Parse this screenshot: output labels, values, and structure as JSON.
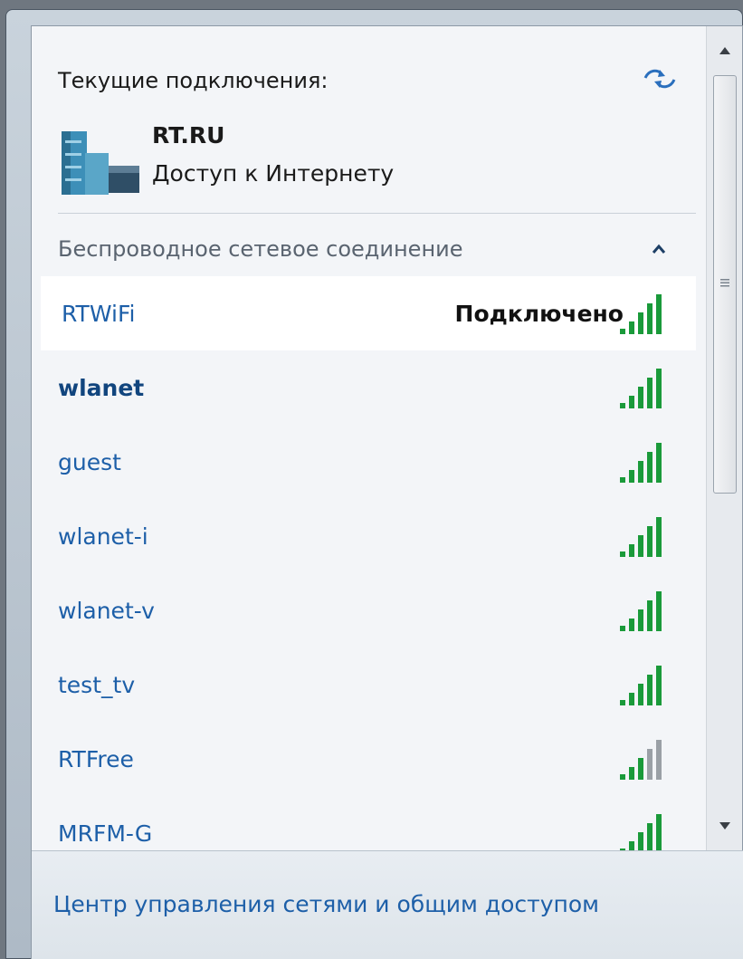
{
  "header": {
    "current_connections_title": "Текущие подключения:",
    "connection": {
      "name": "RT.RU",
      "status": "Доступ к Интернету"
    }
  },
  "section": {
    "label": "Беспроводное сетевое соединение"
  },
  "networks": [
    {
      "name": "RTWiFi",
      "state": "Подключено",
      "signal_bars": 5,
      "selected": true
    },
    {
      "name": "wlanet",
      "state": "",
      "signal_bars": 5,
      "bold": true
    },
    {
      "name": "guest",
      "state": "",
      "signal_bars": 5
    },
    {
      "name": "wlanet-i",
      "state": "",
      "signal_bars": 5
    },
    {
      "name": "wlanet-v",
      "state": "",
      "signal_bars": 5
    },
    {
      "name": "test_tv",
      "state": "",
      "signal_bars": 5
    },
    {
      "name": "RTFree",
      "state": "",
      "signal_bars": 3
    },
    {
      "name": "MRFM-G",
      "state": "",
      "signal_bars": 5
    }
  ],
  "footer": {
    "link": "Центр управления сетями и общим доступом"
  },
  "colors": {
    "link": "#1d5fa8",
    "signal_active": "#1a9a3a",
    "signal_inactive": "#9aa0a6"
  }
}
